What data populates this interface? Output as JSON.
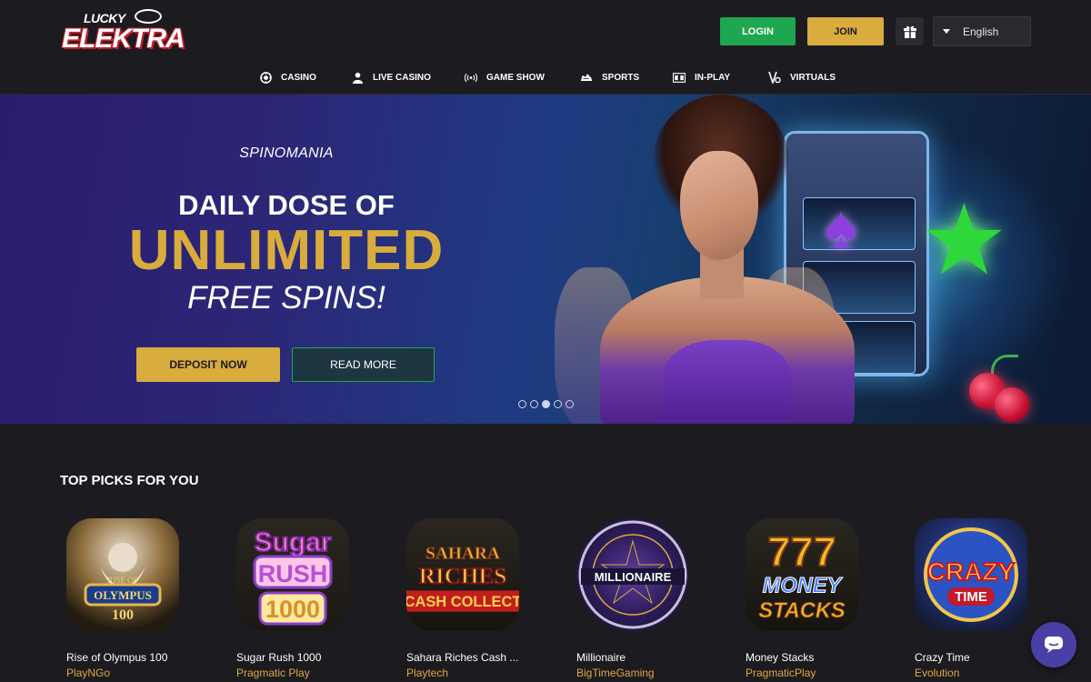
{
  "brand": {
    "logo_top": "LUCKY",
    "logo_main": "ELEKTRA"
  },
  "header": {
    "login_label": "LOGIN",
    "join_label": "JOIN",
    "language": "English",
    "gift_icon": "gift-icon"
  },
  "nav": {
    "items": [
      {
        "label": "CASINO",
        "icon": "poker-chip-icon"
      },
      {
        "label": "LIVE CASINO",
        "icon": "dealer-icon"
      },
      {
        "label": "GAME SHOW",
        "icon": "broadcast-icon"
      },
      {
        "label": "SPORTS",
        "icon": "sports-shoe-icon"
      },
      {
        "label": "IN-PLAY",
        "icon": "scoreboard-icon"
      },
      {
        "label": "VIRTUALS",
        "icon": "virtuals-icon"
      }
    ]
  },
  "hero": {
    "subtitle": "SPINOMANIA",
    "line1": "DAILY DOSE OF",
    "line2": "UNLIMITED",
    "line3": "FREE SPINS!",
    "primary_button": "DEPOSIT NOW",
    "secondary_button": "READ MORE",
    "slides_count": 5,
    "active_slide": 3
  },
  "top_picks": {
    "title": "TOP PICKS FOR YOU",
    "games": [
      {
        "name": "Rise of Olympus 100",
        "provider": "PlayNGo",
        "tile_text": "RISE OF OLYMPUS 100"
      },
      {
        "name": "Sugar Rush 1000",
        "provider": "Pragmatic Play",
        "tile_text": "Sugar RUSH 1000"
      },
      {
        "name": "Sahara Riches Cash ...",
        "provider": "Playtech",
        "tile_text": "SAHARA RICHES CASH COLLECT"
      },
      {
        "name": "Millionaire",
        "provider": "BigTimeGaming",
        "tile_text": "MILLIONAIRE"
      },
      {
        "name": "Money Stacks",
        "provider": "PragmaticPlay",
        "tile_text": "777 MONEY STACKS"
      },
      {
        "name": "Crazy Time",
        "provider": "Evolution",
        "tile_text": "CRAZY TIME"
      }
    ]
  },
  "colors": {
    "accent_gold": "#d8ac3d",
    "login_green": "#1fa651",
    "background": "#1c1b20",
    "provider_text": "#d8ac3d"
  },
  "chat": {
    "icon": "chat-bubble-icon"
  }
}
